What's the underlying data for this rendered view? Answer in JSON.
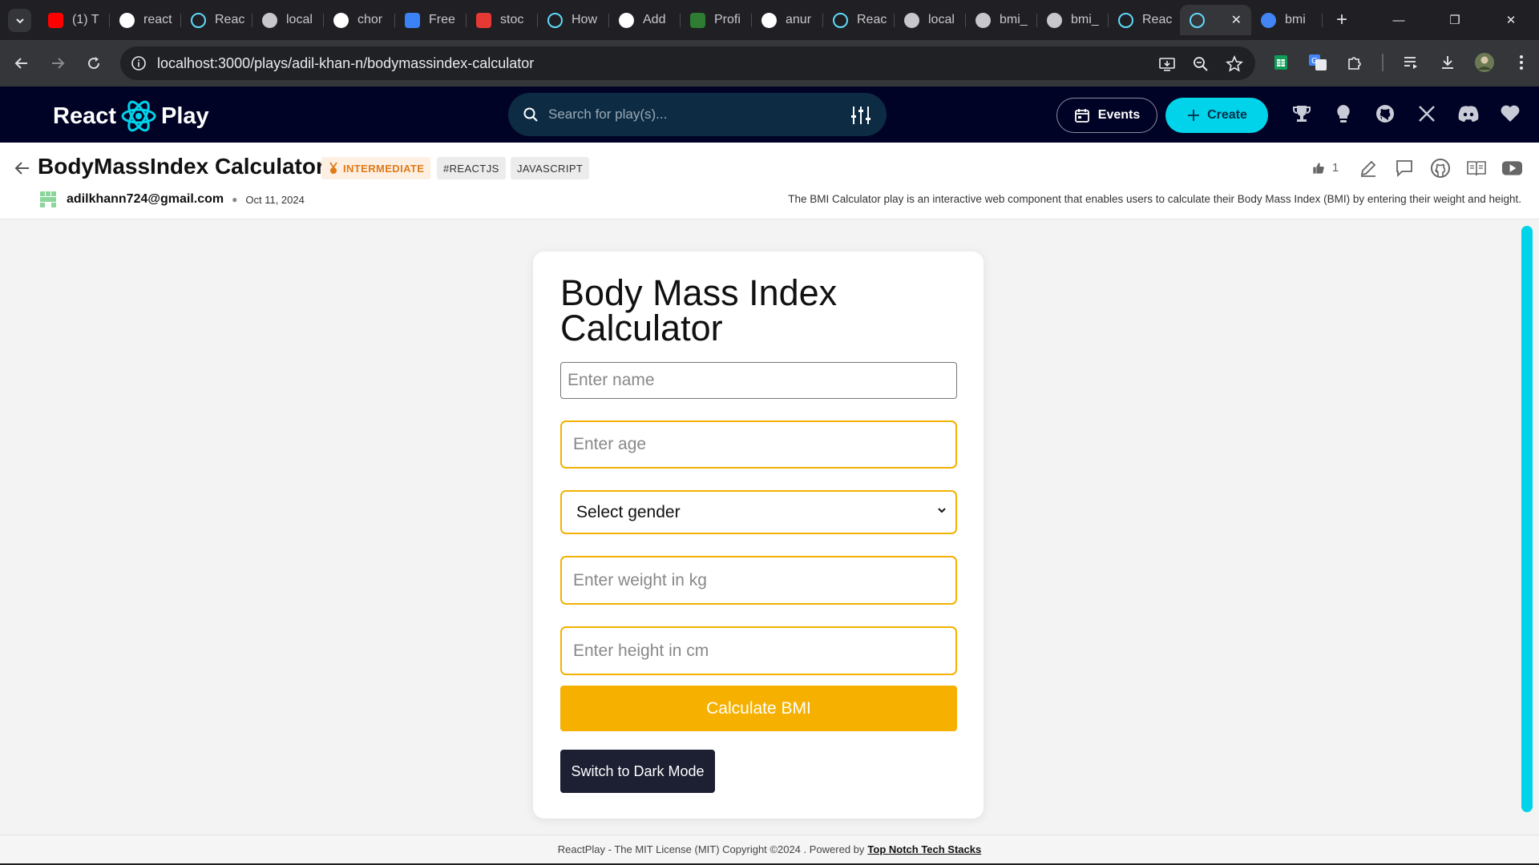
{
  "browser": {
    "tabs": [
      {
        "title": "(1) T",
        "icon": "youtube-icon",
        "color": "#ff0000"
      },
      {
        "title": "react",
        "icon": "github-icon",
        "color": "#ffffff"
      },
      {
        "title": "Reac",
        "icon": "react-icon",
        "color": "#61dafb"
      },
      {
        "title": "local",
        "icon": "globe-icon",
        "color": "#c8c8cc"
      },
      {
        "title": "chor",
        "icon": "github-icon",
        "color": "#ffffff"
      },
      {
        "title": "Free",
        "icon": "forms-icon",
        "color": "#3b82f6"
      },
      {
        "title": "stoc",
        "icon": "app-icon",
        "color": "#e53935"
      },
      {
        "title": "How",
        "icon": "react-icon",
        "color": "#61dafb"
      },
      {
        "title": "Add",
        "icon": "github-icon",
        "color": "#ffffff"
      },
      {
        "title": "Profi",
        "icon": "profile-icon",
        "color": "#2e7d32"
      },
      {
        "title": "anur",
        "icon": "github-icon",
        "color": "#ffffff"
      },
      {
        "title": "Reac",
        "icon": "react-icon",
        "color": "#61dafb"
      },
      {
        "title": "local",
        "icon": "globe-icon",
        "color": "#c8c8cc"
      },
      {
        "title": "bmi_",
        "icon": "globe-icon",
        "color": "#c8c8cc"
      },
      {
        "title": "bmi_",
        "icon": "globe-icon",
        "color": "#c8c8cc"
      },
      {
        "title": "Reac",
        "icon": "react-icon",
        "color": "#61dafb"
      },
      {
        "title": "",
        "icon": "react-icon",
        "color": "#61dafb",
        "active": true
      },
      {
        "title": "bmi",
        "icon": "google-icon",
        "color": "#4285f4"
      }
    ],
    "url": "localhost:3000/plays/adil-khan-n/bodymassindex-calculator"
  },
  "app": {
    "logo_left": "React",
    "logo_right": "Play",
    "search_placeholder": "Search for play(s)...",
    "events_label": "Events",
    "create_label": "Create"
  },
  "play": {
    "title": "BodyMassIndex Calculator",
    "level": "INTERMEDIATE",
    "tags": [
      "#REACTJS",
      "JAVASCRIPT"
    ],
    "author": "adilkhann724@gmail.com",
    "date": "Oct 11, 2024",
    "likes": "1",
    "description": "The BMI Calculator play is an interactive web component that enables users to calculate their Body Mass Index (BMI) by entering their weight and height."
  },
  "calculator": {
    "heading": "Body Mass Index Calculator",
    "name_placeholder": "Enter name",
    "age_placeholder": "Enter age",
    "gender_selected": "Select gender",
    "weight_placeholder": "Enter weight in kg",
    "height_placeholder": "Enter height in cm",
    "calculate_label": "Calculate BMI",
    "dark_mode_label": "Switch to Dark Mode"
  },
  "footer": {
    "text": "ReactPlay - The MIT License (MIT) Copyright ©2024 . Powered by",
    "link": "Top Notch Tech Stacks"
  },
  "colors": {
    "header_bg": "#010326",
    "accent_cyan": "#00d3ea",
    "amber": "#f6b100",
    "dark_button": "#1d1f33"
  }
}
